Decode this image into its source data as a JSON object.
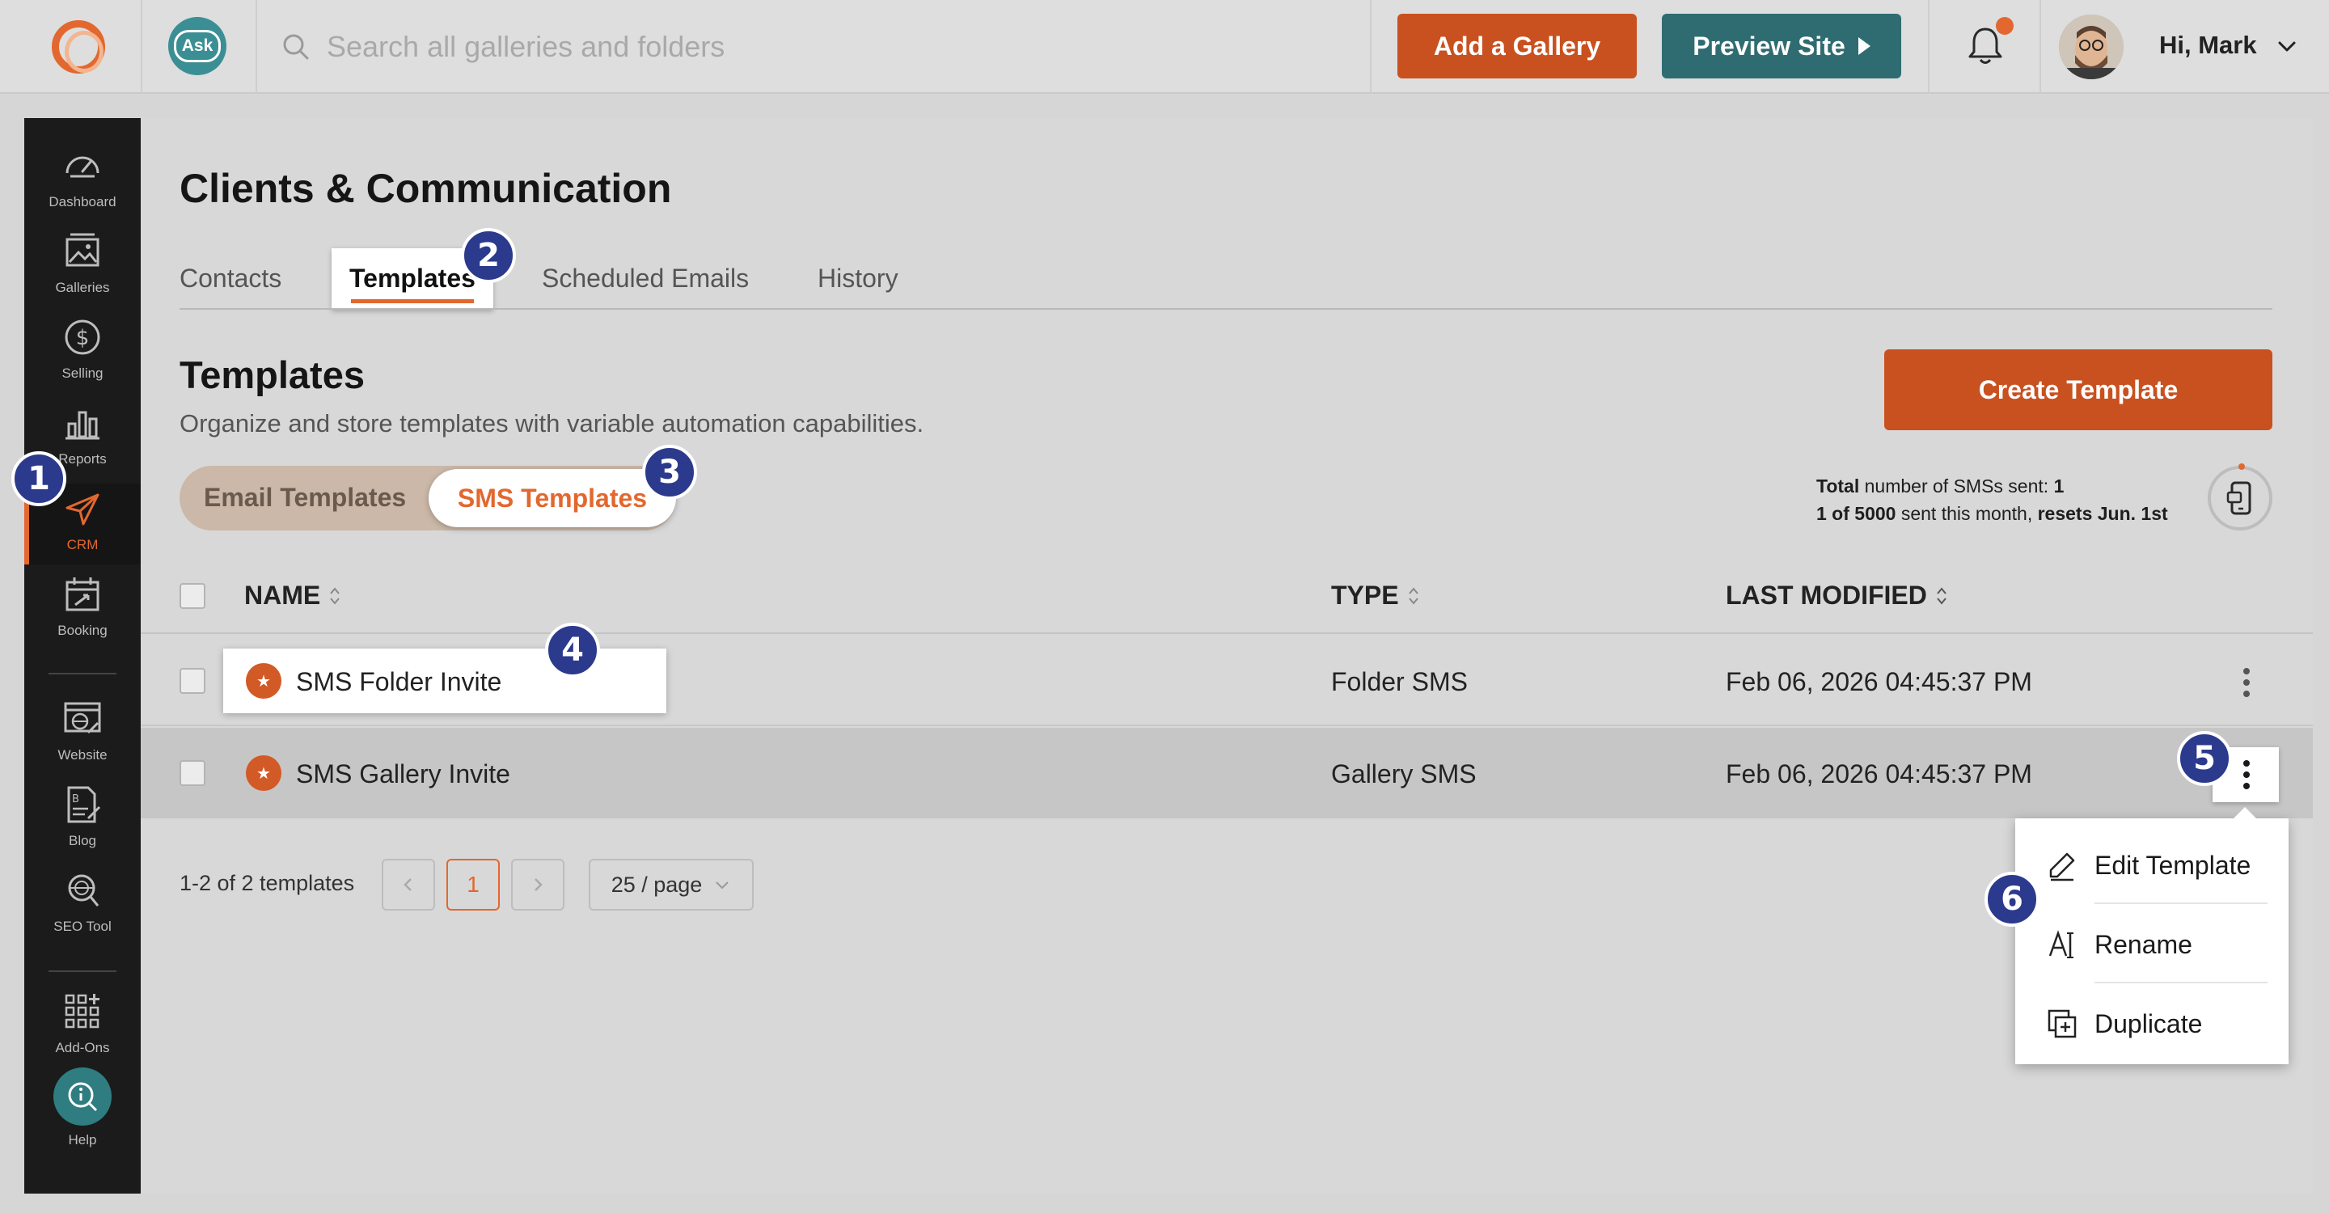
{
  "topbar": {
    "ask_label": "Ask",
    "search_placeholder": "Search all galleries and folders",
    "add_gallery_label": "Add a Gallery",
    "preview_site_label": "Preview Site",
    "greeting": "Hi, Mark"
  },
  "sidebar": {
    "items": [
      {
        "label": "Dashboard",
        "icon": "speedometer-icon"
      },
      {
        "label": "Galleries",
        "icon": "image-stack-icon"
      },
      {
        "label": "Selling",
        "icon": "dollar-circle-icon"
      },
      {
        "label": "Reports",
        "icon": "bar-chart-icon"
      },
      {
        "label": "CRM",
        "icon": "paper-plane-icon",
        "active": true
      },
      {
        "label": "Booking",
        "icon": "calendar-icon"
      },
      {
        "label": "Website",
        "icon": "web-browser-icon"
      },
      {
        "label": "Blog",
        "icon": "blog-document-icon"
      },
      {
        "label": "SEO Tool",
        "icon": "seo-globe-icon"
      },
      {
        "label": "Add-Ons",
        "icon": "grid-plus-icon"
      },
      {
        "label": "Help",
        "icon": "help-search-icon"
      }
    ]
  },
  "page": {
    "title": "Clients & Communication",
    "tabs": [
      {
        "label": "Contacts"
      },
      {
        "label": "Templates",
        "active": true
      },
      {
        "label": "Scheduled Emails"
      },
      {
        "label": "History"
      }
    ]
  },
  "templates": {
    "title": "Templates",
    "subtitle": "Organize and store templates with variable automation capabilities.",
    "create_label": "Create Template",
    "segments": {
      "email": "Email Templates",
      "sms": "SMS Templates",
      "active": "sms"
    },
    "stats": {
      "total_label": "Total",
      "total_text": "number of SMSs sent:",
      "total_value": "1",
      "month_count": "1 of 5000",
      "month_text": "sent this month,",
      "reset_text": "resets Jun. 1st"
    },
    "columns": {
      "name": "NAME",
      "type": "TYPE",
      "modified": "LAST MODIFIED"
    },
    "rows": [
      {
        "name": "SMS Folder Invite",
        "type": "Folder SMS",
        "modified": "Feb 06, 2026 04:45:37 PM"
      },
      {
        "name": "SMS Gallery Invite",
        "type": "Gallery SMS",
        "modified": "Feb 06, 2026 04:45:37 PM"
      }
    ],
    "pagination": {
      "summary": "1-2 of 2 templates",
      "current_page": "1",
      "page_size": "25 / page"
    }
  },
  "context_menu": {
    "items": [
      {
        "label": "Edit Template",
        "icon": "pencil-icon"
      },
      {
        "label": "Rename",
        "icon": "rename-text-icon"
      },
      {
        "label": "Duplicate",
        "icon": "duplicate-icon"
      }
    ]
  },
  "steps": [
    "1",
    "2",
    "3",
    "4",
    "5",
    "6"
  ],
  "colors": {
    "accent": "#e2682f",
    "button_orange": "#c8511f",
    "teal": "#2f6c72",
    "step_badge": "#2b3a8c",
    "sidebar_bg": "#1b1b1b"
  }
}
